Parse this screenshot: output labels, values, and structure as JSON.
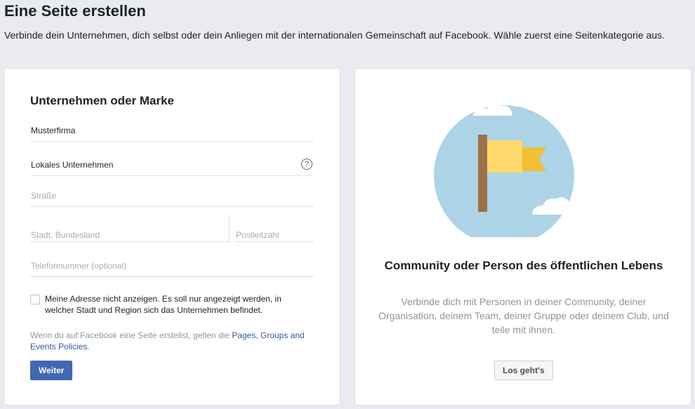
{
  "header": {
    "title": "Eine Seite erstellen",
    "subtitle": "Verbinde dein Unternehmen, dich selbst oder dein Anliegen mit der internationalen Gemeinschaft auf Facebook. Wähle zuerst eine Seitenkategorie aus."
  },
  "business_card": {
    "title": "Unternehmen oder Marke",
    "fields": {
      "name": {
        "value": "Musterfirma",
        "placeholder": ""
      },
      "category": {
        "value": "Lokales Unternehmen",
        "placeholder": ""
      },
      "street": {
        "value": "",
        "placeholder": "Straße"
      },
      "city": {
        "value": "",
        "placeholder": "Stadt, Bundesland"
      },
      "zip": {
        "value": "",
        "placeholder": "Postleitzahl"
      },
      "phone": {
        "value": "",
        "placeholder": "Telefonnummer (optional)"
      }
    },
    "help_glyph": "?",
    "hide_address_label": "Meine Adresse nicht anzeigen. Es soll nur angezeigt werden, in welcher Stadt und Region sich das Unternehmen befindet.",
    "hide_address_checked": false,
    "policy_prefix": "Wenn du auf Facebook eine Seite erstellst, gelten die ",
    "policy_link": "Pages, Groups and Events Policies",
    "policy_suffix": ".",
    "next_button": "Weiter"
  },
  "community_card": {
    "title": "Community oder Person des öffentlichen Lebens",
    "description": "Verbinde dich mit Personen in deiner Community, deiner Organisation, deinem Team, deiner Gruppe oder deinem Club, und teile mit ihnen.",
    "start_button": "Los geht's",
    "illustration_icon": "flag-illustration"
  },
  "colors": {
    "page_background": "#e9ebee",
    "primary_button": "#4267b2",
    "link": "#365899",
    "muted_text": "#90949c",
    "circle": "#acd3e6",
    "flag_front": "#ffd96c",
    "flag_back": "#f2be35",
    "pole": "#9b7148"
  }
}
